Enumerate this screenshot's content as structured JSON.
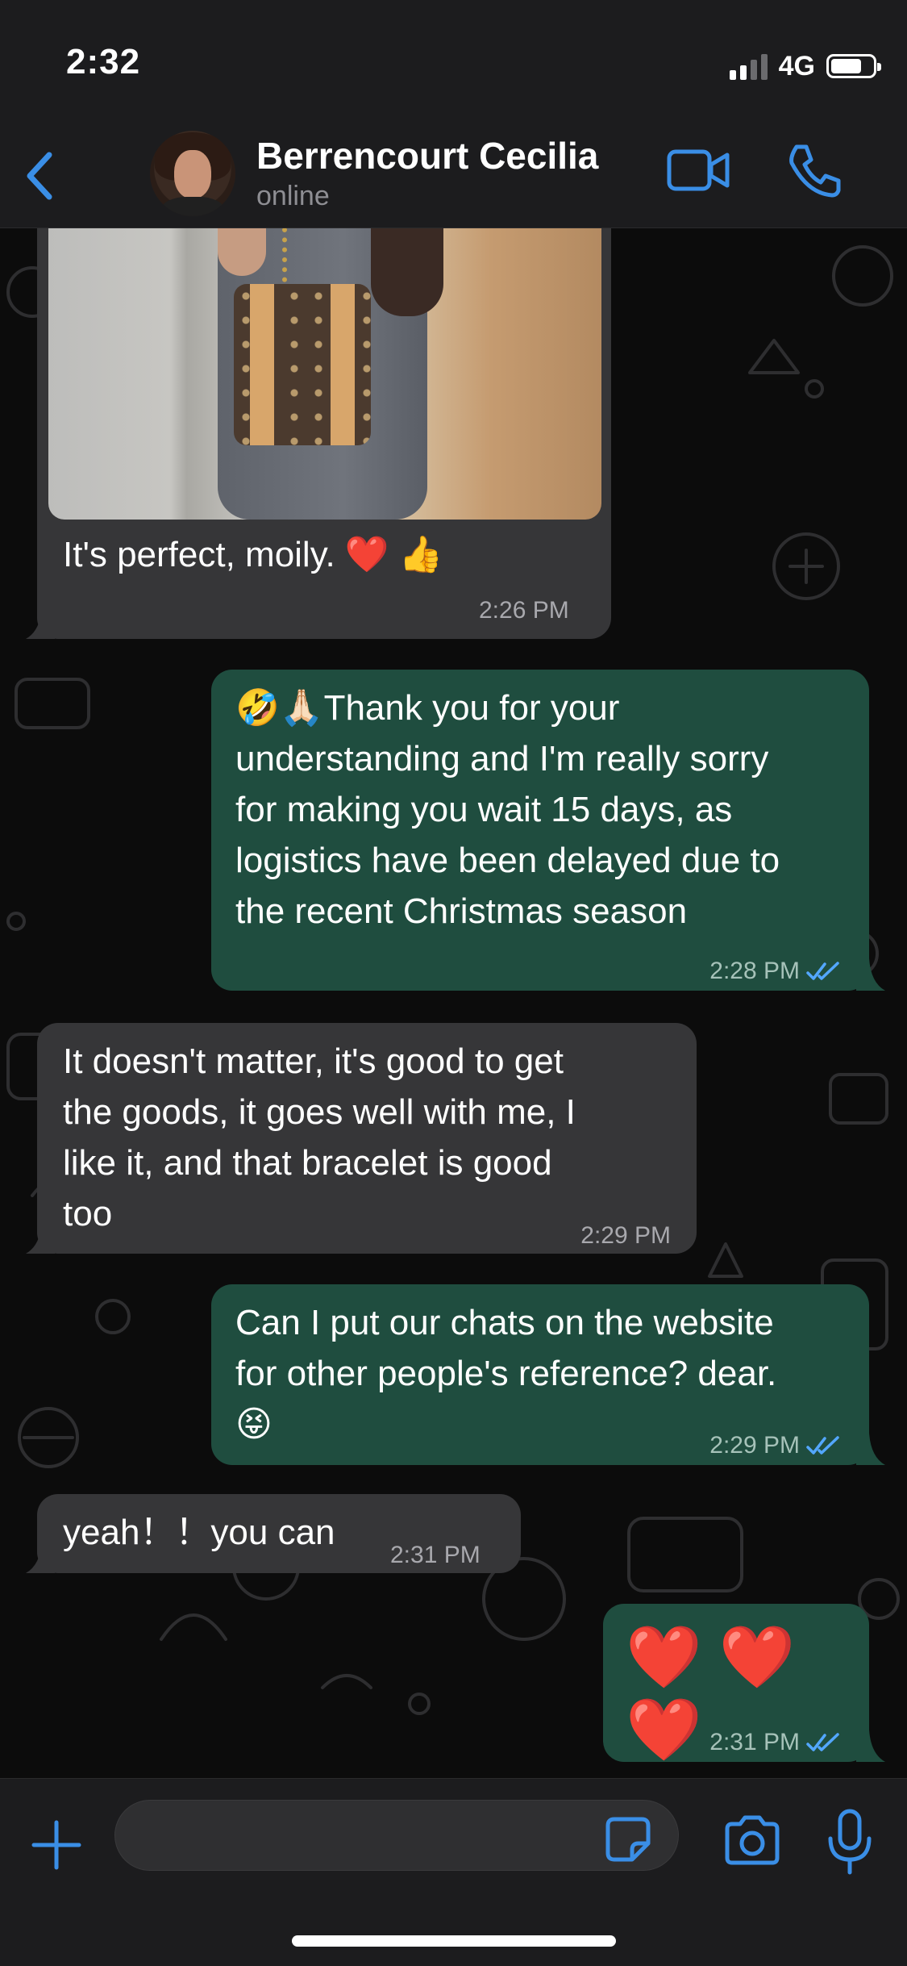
{
  "status_bar": {
    "time": "2:32",
    "network": "4G"
  },
  "header": {
    "contact_name": "Berrencourt Cecilia",
    "contact_status": "online"
  },
  "messages": [
    {
      "direction": "incoming",
      "type": "image",
      "caption": "It's perfect, moily. ❤️ 👍",
      "time": "2:26 PM"
    },
    {
      "direction": "outgoing",
      "text": "🤣🙏🏻Thank you for your\nunderstanding and I'm really sorry\nfor making you wait 15 days, as\nlogistics have been delayed due to\nthe recent Christmas season",
      "time": "2:28 PM",
      "read": true
    },
    {
      "direction": "incoming",
      "text": "It doesn't matter, it's good to get\nthe goods, it goes well with me, I\nlike it, and that bracelet is good\ntoo",
      "time": "2:29 PM"
    },
    {
      "direction": "outgoing",
      "text": "Can I put our chats on the website\nfor other people's reference? dear.\n😝",
      "time": "2:29 PM",
      "read": true
    },
    {
      "direction": "incoming",
      "text": "yeah！！you can",
      "time": "2:31 PM"
    },
    {
      "direction": "outgoing",
      "text": "❤️ ❤️ ❤️",
      "time": "2:31 PM",
      "read": true
    }
  ],
  "colors": {
    "accent": "#3a8ee6",
    "incoming_bubble": "#363638",
    "outgoing_bubble": "#1f4d3f",
    "read_ticks": "#53a7ff"
  },
  "icons": [
    "back-chevron-icon",
    "video-call-icon",
    "phone-icon",
    "plus-icon",
    "sticker-icon",
    "camera-icon",
    "microphone-icon",
    "double-check-icon"
  ]
}
